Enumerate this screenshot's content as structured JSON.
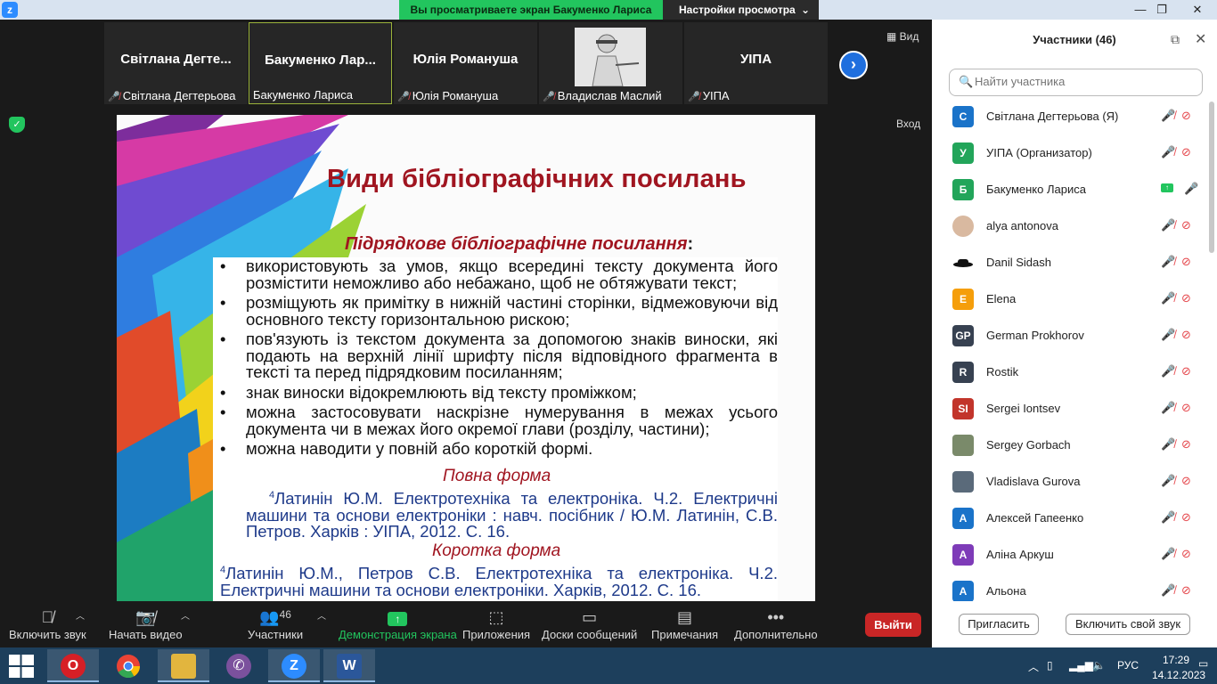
{
  "titlebar": {
    "share_banner": "Вы просматриваете экран Бакуменко Лариса",
    "view_settings": "Настройки просмотра",
    "chevron": "⌄"
  },
  "video_strip": {
    "tiles": [
      {
        "name": "Світлана  Дегте...",
        "label": "Світлана Дегтерьова",
        "muted": true
      },
      {
        "name": "Бакуменко  Лар...",
        "label": "Бакуменко Лариса",
        "muted": false,
        "active": true
      },
      {
        "name": "Юлія Романуша",
        "label": "Юлія Романуша",
        "muted": true
      },
      {
        "name": "",
        "label": "Владислав Маслий",
        "muted": true,
        "has_photo": true
      },
      {
        "name": "УІПА",
        "label": "УІПА",
        "muted": true
      }
    ],
    "view_label": "Вид",
    "enter_label": "Вход"
  },
  "slide": {
    "title": "Види бібліографічних посилань",
    "subtitle": "Підрядкове  бібліографічне  посилання",
    "subtitle_colon": ":",
    "bullets": [
      "використовують за умов, якщо всередині тексту документа його розмістити неможливо або небажано, щоб не обтяжувати текст;",
      "розміщують як примітку в нижній частині сторінки, відмежовуючи від основного тексту горизонтальною рискою;",
      "пов'язують із текстом документа за допомогою знаків виноски, які подають на верхній лінії шрифту після відповідного фрагмента в тексті та перед підрядковим посиланням;",
      "знак виноски відокремлюють від тексту проміжком;",
      "можна застосовувати наскрізне нумерування в межах усього документа чи в межах його окремої глави (розділу, частини);",
      " можна наводити у повній або короткій формі."
    ],
    "full_form_heading": "Повна форма",
    "full_form_sup": "4",
    "full_form_text": "Латинін Ю.М. Електротехніка та електроніка. Ч.2. Електричні машини та основи електроніки : навч. посібник / Ю.М. Латинін, С.В. Петров. Харків : УІПА, 2012. С. 16.",
    "short_form_heading": "Коротка форма",
    "short_form_sup": "4",
    "short_form_text": "Латинін Ю.М., Петров С.В. Електротехніка та електроніка. Ч.2. Електричні машини та основи електроніки. Харків, 2012. С. 16."
  },
  "toolbar": {
    "audio": "Включить звук",
    "video": "Начать видео",
    "participants": "Участники",
    "participants_count": "46",
    "share": "Демонстрация экрана",
    "apps": "Приложения",
    "whiteboards": "Доски сообщений",
    "notes": "Примечания",
    "more": "Дополнительно",
    "exit": "Выйти"
  },
  "panel": {
    "title": "Участники (46)",
    "search_placeholder": "Найти участника",
    "participants": [
      {
        "name": "Світлана Дегтерьова (Я)",
        "initial": "С",
        "color": "#1a73c9"
      },
      {
        "name": "УІПА (Организатор)",
        "initial": "У",
        "color": "#22a55a"
      },
      {
        "name": "Бакуменко Лариса",
        "initial": "Б",
        "color": "#22a55a"
      },
      {
        "name": "alya antonova",
        "initial": "",
        "color": "#d9b9a0"
      },
      {
        "name": "Danil Sidash",
        "initial": "",
        "color": "#ffffff"
      },
      {
        "name": "Elena",
        "initial": "E",
        "color": "#f59e0b"
      },
      {
        "name": "German Prokhorov",
        "initial": "GP",
        "color": "#374151"
      },
      {
        "name": "Rostik",
        "initial": "R",
        "color": "#374151"
      },
      {
        "name": "Sergei Iontsev",
        "initial": "SI",
        "color": "#c2352b"
      },
      {
        "name": "Sergey Gorbach",
        "initial": "",
        "color": "#7a8a6a"
      },
      {
        "name": "Vladislava Gurova",
        "initial": "",
        "color": "#5a6a7a"
      },
      {
        "name": "Алексей Гапеенко",
        "initial": "А",
        "color": "#1a73c9"
      },
      {
        "name": "Аліна Аркуш",
        "initial": "А",
        "color": "#7e3bb8"
      },
      {
        "name": "Альона",
        "initial": "А",
        "color": "#1a73c9"
      }
    ],
    "invite": "Пригласить",
    "unmute_self": "Включить свой звук"
  },
  "taskbar": {
    "apps": [
      {
        "name": "opera",
        "color": "#d61f26",
        "glyph": "O"
      },
      {
        "name": "chrome",
        "color": "#ea4335",
        "glyph": ""
      },
      {
        "name": "explorer",
        "color": "#e2b53e",
        "glyph": ""
      },
      {
        "name": "viber",
        "color": "#7b519d",
        "glyph": ""
      },
      {
        "name": "zoom",
        "color": "#2d8cff",
        "glyph": "Z"
      },
      {
        "name": "word",
        "color": "#2b579a",
        "glyph": "W"
      }
    ],
    "lang": "РУС",
    "time": "17:29",
    "date": "14.12.2023"
  }
}
